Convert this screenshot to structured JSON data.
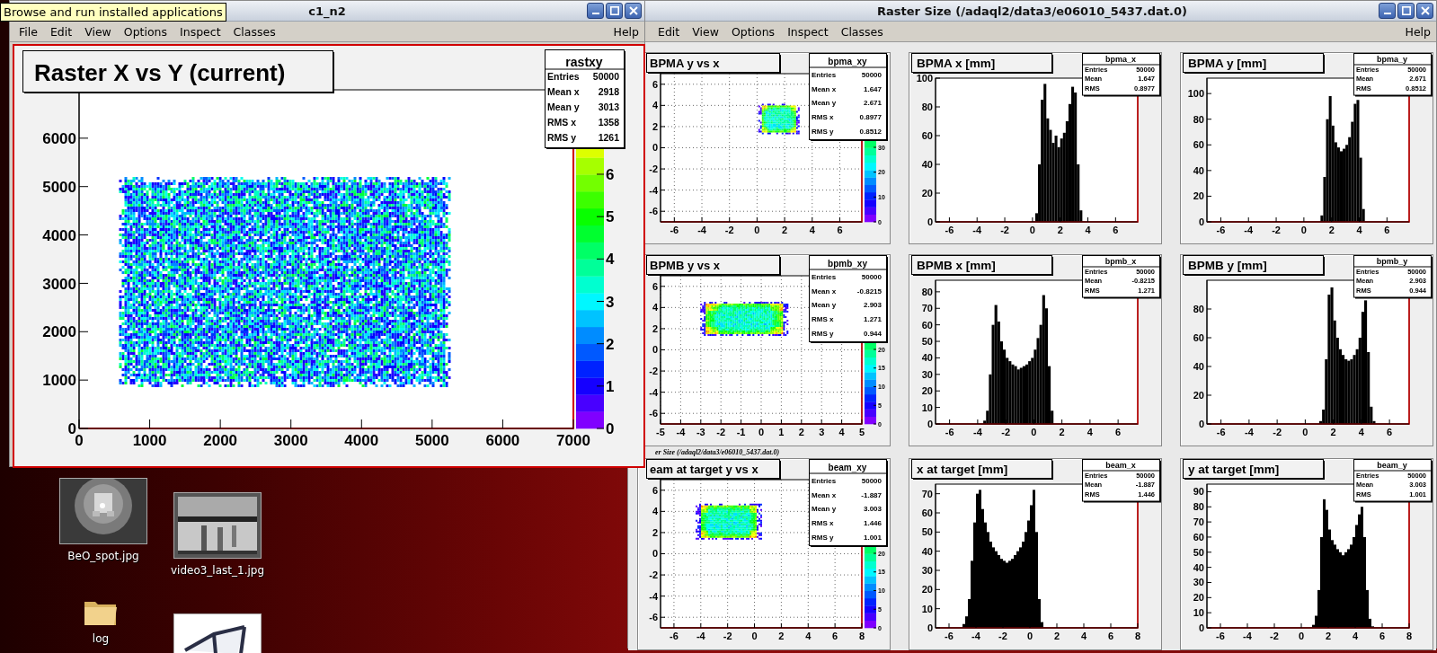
{
  "tooltip": "Browse and run installed applications",
  "canvas_window": {
    "title": "c1_n2",
    "menu": [
      "File",
      "Edit",
      "View",
      "Options",
      "Inspect",
      "Classes"
    ],
    "help_menu": "Help",
    "plot": {
      "kind": "hist2d",
      "title": "Raster X vs Y (current)",
      "stats": {
        "name": "rastxy",
        "rows": [
          {
            "label": "Entries",
            "value": "50000"
          },
          {
            "label": "Mean x",
            "value": "2918"
          },
          {
            "label": "Mean y",
            "value": "3013"
          },
          {
            "label": "RMS x",
            "value": "1358"
          },
          {
            "label": "RMS y",
            "value": "1261"
          }
        ]
      },
      "color_scale": {
        "labels": [
          "6",
          "5",
          "4",
          "3",
          "2",
          "1",
          "0"
        ]
      },
      "chart_data": {
        "type": "scatter",
        "xlim": [
          0,
          7000
        ],
        "ylim": [
          0,
          7000
        ],
        "xticks": [
          0,
          1000,
          2000,
          3000,
          4000,
          5000,
          6000,
          7000
        ],
        "yticks": [
          0,
          1000,
          2000,
          3000,
          4000,
          5000,
          6000
        ],
        "grid": false
      }
    }
  },
  "raster_window": {
    "title": "Raster Size (/adaql2/data3/e06010_5437.dat.0)",
    "menu": [
      "Edit",
      "View",
      "Options",
      "Inspect",
      "Classes"
    ],
    "help_menu": "Help",
    "status_text": "er Size (/adaql2/data3/e06010_5437.dat.0)",
    "pads": [
      {
        "kind": "hist2d",
        "title": "BPMA y vs x",
        "stats": {
          "name": "bpma_xy",
          "rows": [
            {
              "label": "Entries",
              "value": "50000"
            },
            {
              "label": "Mean x",
              "value": "1.647"
            },
            {
              "label": "Mean y",
              "value": "2.671"
            },
            {
              "label": "RMS x",
              "value": "0.8977"
            },
            {
              "label": "RMS y",
              "value": "0.8512"
            }
          ]
        },
        "color_scale": {
          "labels": [
            "30",
            "20",
            "10",
            "0"
          ]
        },
        "chart_data": {
          "type": "scatter",
          "xlim": [
            -7,
            7.6
          ],
          "ylim": [
            -7,
            7
          ],
          "xticks": [
            -6,
            -4,
            -2,
            0,
            2,
            4,
            6
          ],
          "yticks": [
            -6,
            -4,
            -2,
            0,
            2,
            4,
            6
          ],
          "grid": true
        }
      },
      {
        "kind": "hist1d",
        "title": "BPMA x [mm]",
        "stats": {
          "name": "bpma_x",
          "rows": [
            {
              "label": "Entries",
              "value": "50000"
            },
            {
              "label": "Mean",
              "value": "1.647"
            },
            {
              "label": "RMS",
              "value": "0.8977"
            }
          ]
        },
        "chart_data": {
          "type": "bar",
          "xlim": [
            -7,
            7.6
          ],
          "ylim": [
            0,
            100
          ],
          "xticks": [
            -6,
            -4,
            -2,
            0,
            2,
            4,
            6
          ],
          "yticks": [
            0,
            20,
            40,
            60,
            80,
            100
          ],
          "x": [
            0.1,
            0.3,
            0.5,
            0.7,
            0.9,
            1.1,
            1.3,
            1.5,
            1.7,
            1.9,
            2.1,
            2.3,
            2.5,
            2.7,
            2.9,
            3.1,
            3.3,
            3.5,
            3.7
          ],
          "values": [
            0,
            6,
            40,
            85,
            96,
            72,
            64,
            55,
            60,
            52,
            58,
            62,
            70,
            82,
            94,
            90,
            40,
            8,
            0
          ]
        }
      },
      {
        "kind": "hist1d",
        "title": "BPMA y [mm]",
        "stats": {
          "name": "bpma_y",
          "rows": [
            {
              "label": "Entries",
              "value": "50000"
            },
            {
              "label": "Mean",
              "value": "2.671"
            },
            {
              "label": "RMS",
              "value": "0.8512"
            }
          ]
        },
        "chart_data": {
          "type": "bar",
          "xlim": [
            -7,
            7.6
          ],
          "ylim": [
            0,
            112
          ],
          "xticks": [
            -6,
            -4,
            -2,
            0,
            2,
            4,
            6
          ],
          "yticks": [
            0,
            20,
            40,
            60,
            80,
            100
          ],
          "x": [
            1.1,
            1.3,
            1.5,
            1.7,
            1.9,
            2.1,
            2.3,
            2.5,
            2.7,
            2.9,
            3.1,
            3.3,
            3.5,
            3.7,
            3.9,
            4.1,
            4.3,
            4.5
          ],
          "values": [
            0,
            5,
            35,
            80,
            98,
            75,
            62,
            58,
            55,
            57,
            60,
            66,
            78,
            92,
            95,
            50,
            10,
            0
          ]
        }
      },
      {
        "kind": "hist2d",
        "title": "BPMB y vs x",
        "stats": {
          "name": "bpmb_xy",
          "rows": [
            {
              "label": "Entries",
              "value": "50000"
            },
            {
              "label": "Mean x",
              "value": "-0.8215"
            },
            {
              "label": "Mean y",
              "value": "2.903"
            },
            {
              "label": "RMS x",
              "value": "1.271"
            },
            {
              "label": "RMS y",
              "value": "0.944"
            }
          ]
        },
        "color_scale": {
          "labels": [
            "20",
            "15",
            "10",
            "5",
            "0"
          ]
        },
        "chart_data": {
          "type": "scatter",
          "xlim": [
            -5,
            5
          ],
          "ylim": [
            -7,
            7
          ],
          "xticks": [
            -5,
            -4,
            -3,
            -2,
            -1,
            0,
            1,
            2,
            3,
            4,
            5
          ],
          "yticks": [
            -6,
            -4,
            -2,
            0,
            2,
            4,
            6
          ],
          "grid": true
        }
      },
      {
        "kind": "hist1d",
        "title": "BPMB x [mm]",
        "stats": {
          "name": "bpmb_x",
          "rows": [
            {
              "label": "Entries",
              "value": "50000"
            },
            {
              "label": "Mean",
              "value": "-0.8215"
            },
            {
              "label": "RMS",
              "value": "1.271"
            }
          ]
        },
        "chart_data": {
          "type": "bar",
          "xlim": [
            -7,
            7.4
          ],
          "ylim": [
            0,
            87
          ],
          "xticks": [
            -6,
            -4,
            -2,
            0,
            2,
            4,
            6
          ],
          "yticks": [
            0,
            10,
            20,
            30,
            40,
            50,
            60,
            70,
            80
          ],
          "x": [
            -3.7,
            -3.5,
            -3.3,
            -3.1,
            -2.9,
            -2.7,
            -2.5,
            -2.3,
            -2.1,
            -1.9,
            -1.7,
            -1.5,
            -1.3,
            -1.1,
            -0.9,
            -0.7,
            -0.5,
            -0.3,
            -0.1,
            0.1,
            0.3,
            0.5,
            0.7,
            0.9,
            1.1,
            1.3,
            1.5,
            1.7
          ],
          "values": [
            0,
            2,
            8,
            30,
            60,
            72,
            62,
            50,
            45,
            40,
            38,
            36,
            35,
            33,
            34,
            35,
            36,
            38,
            40,
            45,
            52,
            60,
            78,
            70,
            35,
            8,
            null,
            0
          ]
        }
      },
      {
        "kind": "hist1d",
        "title": "BPMB y [mm]",
        "stats": {
          "name": "bpmb_y",
          "rows": [
            {
              "label": "Entries",
              "value": "50000"
            },
            {
              "label": "Mean",
              "value": "2.903"
            },
            {
              "label": "RMS",
              "value": "0.944"
            }
          ]
        },
        "chart_data": {
          "type": "bar",
          "xlim": [
            -7,
            7.4
          ],
          "ylim": [
            0,
            100
          ],
          "xticks": [
            -6,
            -4,
            -2,
            0,
            2,
            4,
            6
          ],
          "yticks": [
            0,
            20,
            40,
            60,
            80
          ],
          "x": [
            0.9,
            1.1,
            1.3,
            1.5,
            1.7,
            1.9,
            2.1,
            2.3,
            2.5,
            2.7,
            2.9,
            3.1,
            3.3,
            3.5,
            3.7,
            3.9,
            4.1,
            4.3,
            4.5,
            4.7,
            4.9,
            5.1
          ],
          "values": [
            0,
            2,
            10,
            45,
            90,
            95,
            72,
            60,
            52,
            48,
            45,
            44,
            45,
            48,
            52,
            60,
            78,
            86,
            50,
            12,
            2,
            0
          ]
        }
      },
      {
        "kind": "hist2d",
        "title": "eam at target y vs x",
        "stats": {
          "name": "beam_xy",
          "rows": [
            {
              "label": "Entries",
              "value": "50000"
            },
            {
              "label": "Mean x",
              "value": "-1.887"
            },
            {
              "label": "Mean y",
              "value": "3.003"
            },
            {
              "label": "RMS x",
              "value": "1.446"
            },
            {
              "label": "RMS y",
              "value": "1.001"
            }
          ]
        },
        "color_scale": {
          "labels": [
            "20",
            "15",
            "10",
            "5",
            "0"
          ]
        },
        "chart_data": {
          "type": "scatter",
          "xlim": [
            -7,
            8
          ],
          "ylim": [
            -7,
            7
          ],
          "xticks": [
            -6,
            -4,
            -2,
            0,
            2,
            4,
            6,
            8
          ],
          "yticks": [
            -6,
            -4,
            -2,
            0,
            2,
            4,
            6
          ],
          "grid": true
        }
      },
      {
        "kind": "hist1d",
        "title": "x at target [mm]",
        "stats": {
          "name": "beam_x",
          "rows": [
            {
              "label": "Entries",
              "value": "50000"
            },
            {
              "label": "Mean",
              "value": "-1.887"
            },
            {
              "label": "RMS",
              "value": "1.446"
            }
          ]
        },
        "chart_data": {
          "type": "bar",
          "xlim": [
            -7,
            8
          ],
          "ylim": [
            0,
            75
          ],
          "xticks": [
            -6,
            -4,
            -2,
            0,
            2,
            4,
            6,
            8
          ],
          "yticks": [
            0,
            10,
            20,
            30,
            40,
            50,
            60,
            70
          ],
          "x": [
            -5.1,
            -4.9,
            -4.7,
            -4.5,
            -4.3,
            -4.1,
            -3.9,
            -3.7,
            -3.5,
            -3.3,
            -3.1,
            -2.9,
            -2.7,
            -2.5,
            -2.3,
            -2.1,
            -1.9,
            -1.7,
            -1.5,
            -1.3,
            -1.1,
            -0.9,
            -0.7,
            -0.5,
            -0.3,
            -0.1,
            0.1,
            0.3,
            0.5,
            0.7,
            0.9,
            1.1
          ],
          "values": [
            0,
            2,
            6,
            15,
            35,
            55,
            70,
            72,
            62,
            55,
            50,
            45,
            42,
            40,
            38,
            36,
            35,
            34,
            35,
            36,
            38,
            40,
            42,
            45,
            50,
            56,
            64,
            72,
            50,
            15,
            3,
            0
          ]
        }
      },
      {
        "kind": "hist1d",
        "title": "y at target [mm]",
        "stats": {
          "name": "beam_y",
          "rows": [
            {
              "label": "Entries",
              "value": "50000"
            },
            {
              "label": "Mean",
              "value": "3.003"
            },
            {
              "label": "RMS",
              "value": "1.001"
            }
          ]
        },
        "chart_data": {
          "type": "bar",
          "xlim": [
            -7,
            8
          ],
          "ylim": [
            0,
            95
          ],
          "xticks": [
            -6,
            -4,
            -2,
            0,
            2,
            4,
            6,
            8
          ],
          "yticks": [
            0,
            10,
            20,
            30,
            40,
            50,
            60,
            70,
            80,
            90
          ],
          "x": [
            0.7,
            0.9,
            1.1,
            1.3,
            1.5,
            1.7,
            1.9,
            2.1,
            2.3,
            2.5,
            2.7,
            2.9,
            3.1,
            3.3,
            3.5,
            3.7,
            3.9,
            4.1,
            4.3,
            4.5,
            4.7,
            4.9,
            5.1,
            5.3,
            5.5
          ],
          "values": [
            0,
            2,
            8,
            25,
            60,
            85,
            78,
            65,
            58,
            55,
            52,
            50,
            48,
            50,
            52,
            55,
            60,
            68,
            75,
            80,
            60,
            25,
            6,
            1,
            0
          ]
        }
      }
    ]
  },
  "desktop_icons": [
    {
      "kind": "picture",
      "label": "BeO_spot.jpg"
    },
    {
      "kind": "picture",
      "label": "video3_last_1.jpg"
    },
    {
      "kind": "folder",
      "label": "log"
    },
    {
      "kind": "picture"
    }
  ]
}
